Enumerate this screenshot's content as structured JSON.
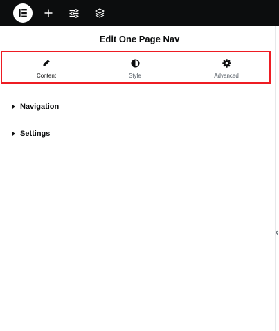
{
  "topbar": {
    "logo_icon": "elementor-logo-icon",
    "buttons": [
      {
        "icon": "plus-icon"
      },
      {
        "icon": "sliders-icon"
      },
      {
        "icon": "layers-icon"
      }
    ],
    "background": "#0c0d0e"
  },
  "panel": {
    "title": "Edit One Page Nav"
  },
  "tabs": [
    {
      "label": "Content",
      "icon": "pencil-icon",
      "active": true
    },
    {
      "label": "Style",
      "icon": "half-circle-icon",
      "active": false
    },
    {
      "label": "Advanced",
      "icon": "gear-icon",
      "active": false
    }
  ],
  "highlight_color": "#ee1c23",
  "sections": [
    {
      "label": "Navigation",
      "expanded": false
    },
    {
      "label": "Settings",
      "expanded": false
    }
  ]
}
